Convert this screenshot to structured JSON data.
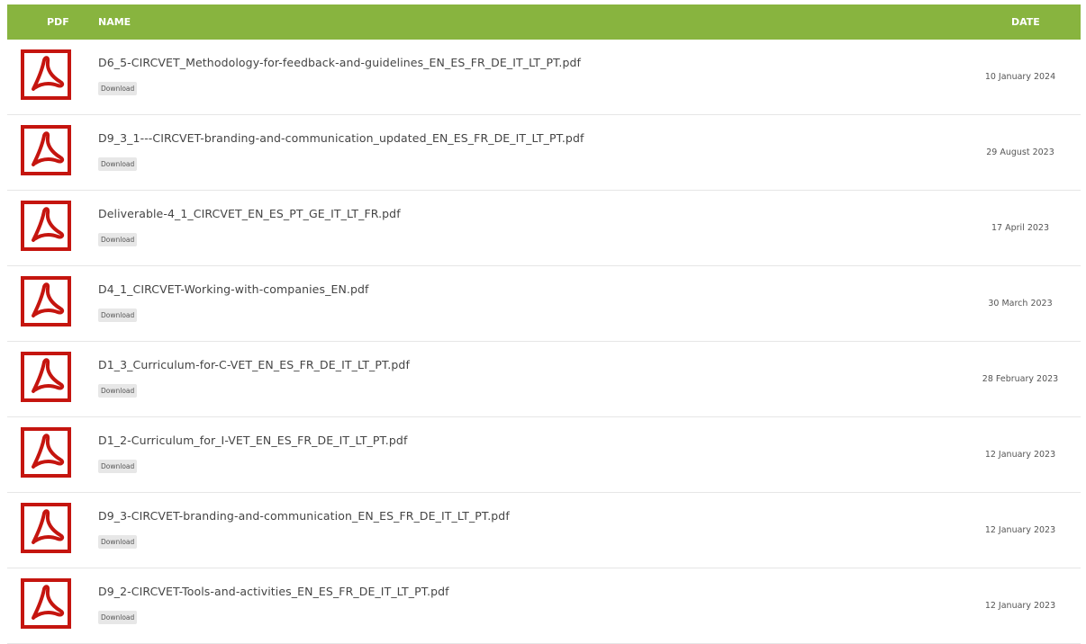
{
  "header": {
    "pdf_label": "PDF",
    "name_label": "NAME",
    "date_label": "DATE"
  },
  "colors": {
    "header_bg": "#88b43f",
    "pdf_red": "#c5150f"
  },
  "rows": [
    {
      "name": "D6_5-CIRCVET_Methodology-for-feedback-and-guidelines_EN_ES_FR_DE_IT_LT_PT.pdf",
      "download": "Download",
      "date": "10 January 2024",
      "icon": "pdf-icon"
    },
    {
      "name": "D9_3_1---CIRCVET-branding-and-communication_updated_EN_ES_FR_DE_IT_LT_PT.pdf",
      "download": "Download",
      "date": "29 August 2023",
      "icon": "pdf-icon"
    },
    {
      "name": "Deliverable-4_1_CIRCVET_EN_ES_PT_GE_IT_LT_FR.pdf",
      "download": "Download",
      "date": "17 April 2023",
      "icon": "pdf-icon"
    },
    {
      "name": "D4_1_CIRCVET-Working-with-companies_EN.pdf",
      "download": "Download",
      "date": "30 March 2023",
      "icon": "pdf-icon"
    },
    {
      "name": "D1_3_Curriculum-for-C-VET_EN_ES_FR_DE_IT_LT_PT.pdf",
      "download": "Download",
      "date": "28 February 2023",
      "icon": "pdf-icon"
    },
    {
      "name": "D1_2-Curriculum_for_I-VET_EN_ES_FR_DE_IT_LT_PT.pdf",
      "download": "Download",
      "date": "12 January 2023",
      "icon": "pdf-icon"
    },
    {
      "name": "D9_3-CIRCVET-branding-and-communication_EN_ES_FR_DE_IT_LT_PT.pdf",
      "download": "Download",
      "date": "12 January 2023",
      "icon": "pdf-icon"
    },
    {
      "name": "D9_2-CIRCVET-Tools-and-activities_EN_ES_FR_DE_IT_LT_PT.pdf",
      "download": "Download",
      "date": "12 January 2023",
      "icon": "pdf-icon"
    }
  ]
}
